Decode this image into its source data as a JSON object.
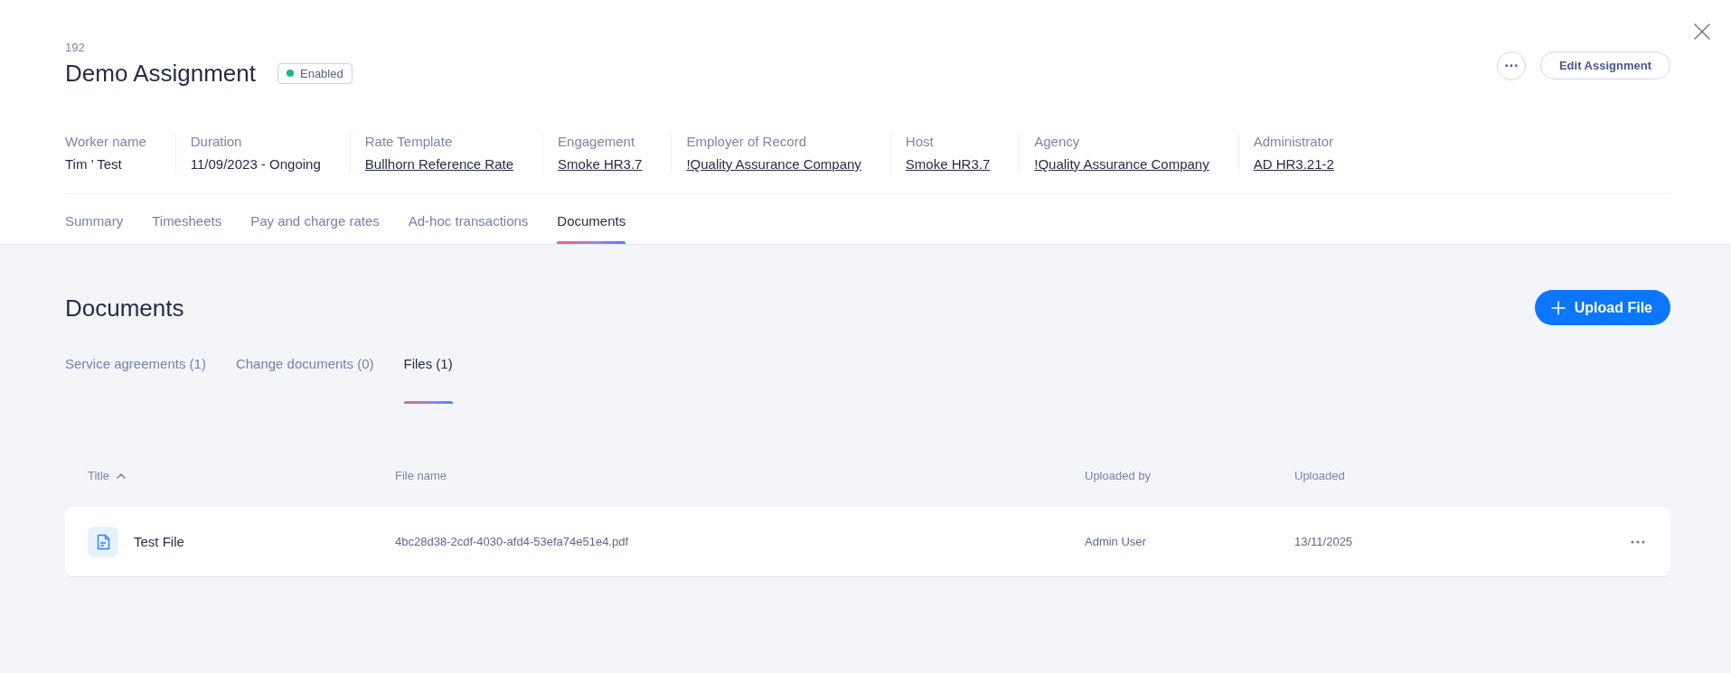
{
  "header": {
    "id": "192",
    "title": "Demo Assignment",
    "status": {
      "label": "Enabled",
      "enabled": true
    },
    "edit_button": "Edit Assignment"
  },
  "details": [
    {
      "label": "Worker name",
      "value": "Tim ’ Test",
      "kind": "text"
    },
    {
      "label": "Duration",
      "value": "11/09/2023 - Ongoing",
      "kind": "text"
    },
    {
      "label": "Rate Template",
      "value": "Bullhorn Reference Rate",
      "kind": "link"
    },
    {
      "label": "Engagement",
      "value": "Smoke HR3.7",
      "kind": "link"
    },
    {
      "label": "Employer of Record",
      "value": "!Quality Assurance Company",
      "kind": "link"
    },
    {
      "label": "Host",
      "value": "Smoke HR3.7",
      "kind": "link"
    },
    {
      "label": "Agency",
      "value": "!Quality Assurance Company",
      "kind": "link"
    },
    {
      "label": "Administrator",
      "value": "AD HR3.21-2",
      "kind": "link"
    }
  ],
  "tabs": [
    {
      "label": "Summary",
      "selected": false
    },
    {
      "label": "Timesheets",
      "selected": false
    },
    {
      "label": "Pay and charge rates",
      "selected": false
    },
    {
      "label": "Ad-hoc transactions",
      "selected": false
    },
    {
      "label": "Documents",
      "selected": true
    }
  ],
  "documents": {
    "title": "Documents",
    "upload_button": "Upload File",
    "subtabs": [
      {
        "label": "Service agreements (1)",
        "selected": false
      },
      {
        "label": "Change documents (0)",
        "selected": false
      },
      {
        "label": "Files (1)",
        "selected": true
      }
    ],
    "table": {
      "columns": [
        {
          "label": "Title",
          "sorted": true
        },
        {
          "label": "File name",
          "sorted": false
        },
        {
          "label": "Uploaded by",
          "sorted": false
        },
        {
          "label": "Uploaded",
          "sorted": false
        }
      ],
      "rows": [
        {
          "title": "Test File",
          "file_name": "4bc28d38-2cdf-4030-afd4-53efa74e51e4.pdf",
          "uploaded_by": "Admin User",
          "uploaded": "13/11/2025"
        }
      ]
    }
  }
}
